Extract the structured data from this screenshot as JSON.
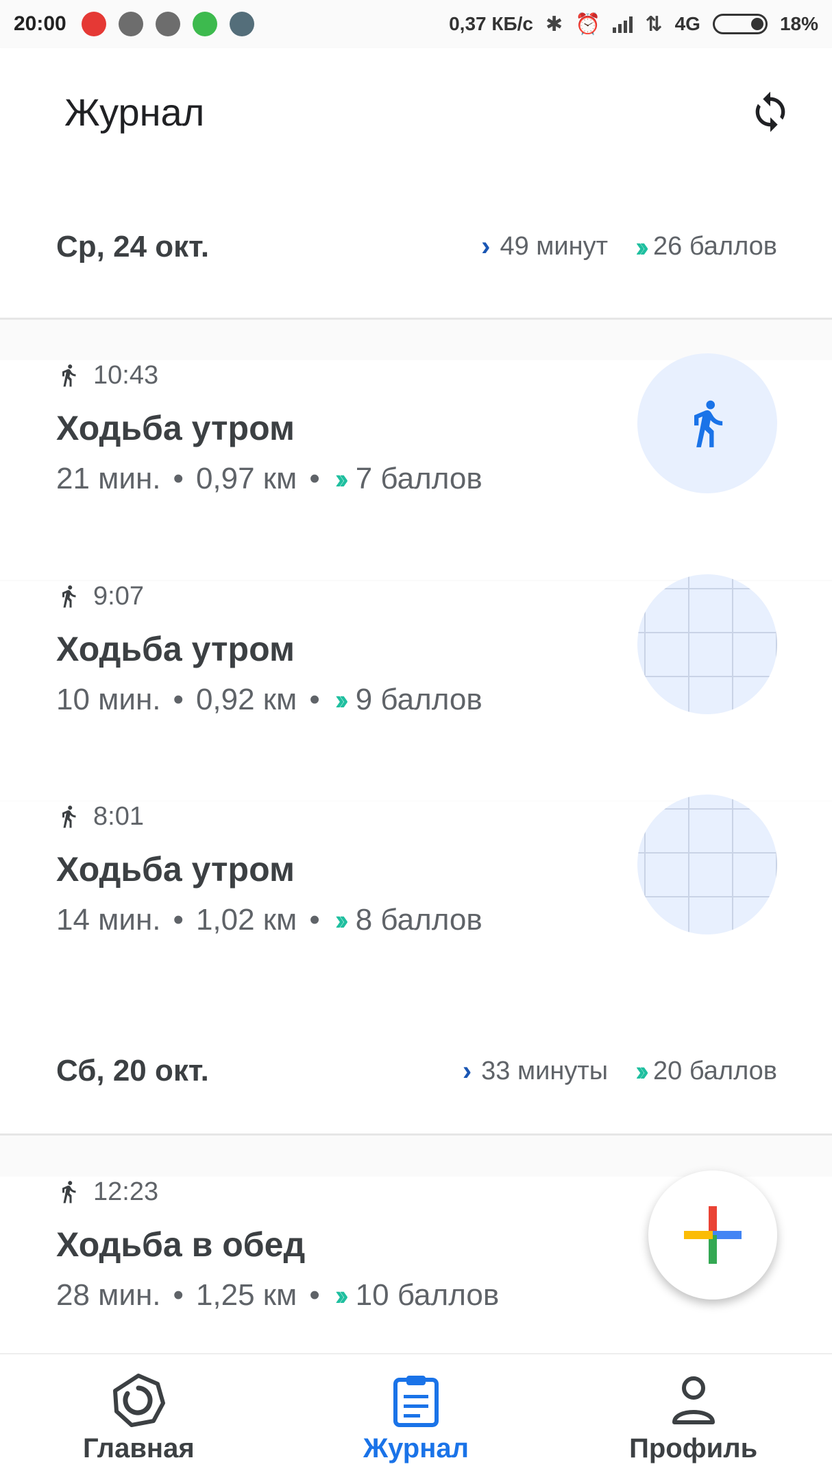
{
  "status_bar": {
    "time": "20:00",
    "network_speed": "0,37 КБ/с",
    "network_type": "4G",
    "battery": "18%"
  },
  "app_bar": {
    "title": "Журнал",
    "sync_icon": "sync-icon"
  },
  "colors": {
    "accent_blue": "#1a73e8",
    "heart_points_teal": "#1fbf9f",
    "move_minutes_blue": "#1a56b3"
  },
  "days": [
    {
      "date": "Ср, 24 окт.",
      "minutes": "49 минут",
      "points": "26 баллов",
      "entries": [
        {
          "time": "10:43",
          "title": "Ходьба утром",
          "duration": "21 мин.",
          "distance": "0,97 км",
          "points": "7 баллов",
          "thumb": "walking-icon"
        },
        {
          "time": "9:07",
          "title": "Ходьба утром",
          "duration": "10 мин.",
          "distance": "0,92 км",
          "points": "9 баллов",
          "thumb": "map-thumbnail"
        },
        {
          "time": "8:01",
          "title": "Ходьба утром",
          "duration": "14 мин.",
          "distance": "1,02 км",
          "points": "8 баллов",
          "thumb": "map-thumbnail"
        }
      ]
    },
    {
      "date": "Сб, 20 окт.",
      "minutes": "33 минуты",
      "points": "20 баллов",
      "entries": [
        {
          "time": "12:23",
          "title": "Ходьба в обед",
          "duration": "28 мин.",
          "distance": "1,25 км",
          "points": "10 баллов",
          "thumb": "map-thumbnail"
        }
      ]
    }
  ],
  "bottom_nav": [
    {
      "label": "Главная",
      "icon": "home-ring-icon"
    },
    {
      "label": "Журнал",
      "icon": "journal-icon",
      "active": true
    },
    {
      "label": "Профиль",
      "icon": "profile-icon"
    }
  ]
}
